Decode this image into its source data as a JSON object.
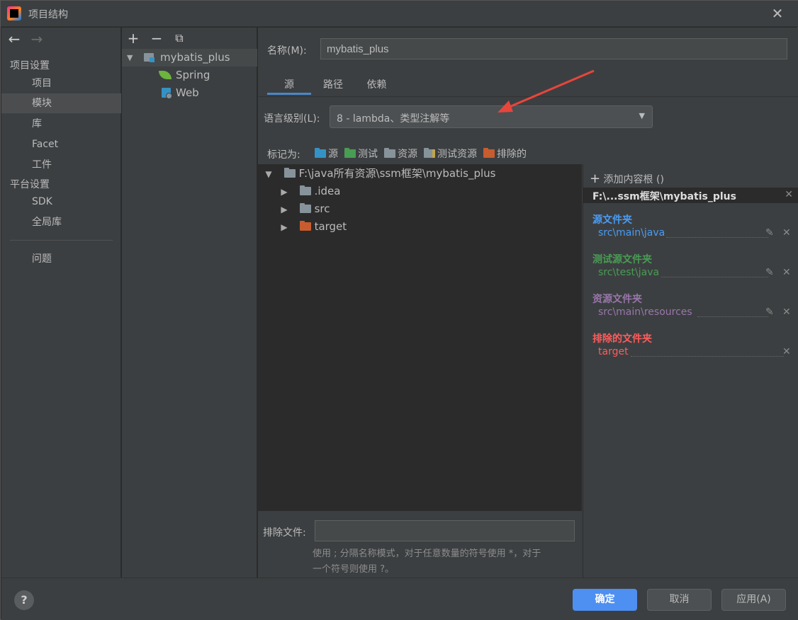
{
  "window": {
    "title": "项目结构",
    "close_glyph": "✕"
  },
  "nav": {
    "back_glyph": "←",
    "forward_glyph": "→",
    "project_settings_header": "项目设置",
    "project_items": [
      "项目",
      "模块",
      "库",
      "Facet",
      "工件"
    ],
    "platform_settings_header": "平台设置",
    "platform_items": [
      "SDK",
      "全局库"
    ],
    "problems_label": "问题",
    "selected": "模块"
  },
  "module_list": {
    "toolbar": {
      "add_glyph": "+",
      "remove_glyph": "−",
      "copy_glyph": "⧉"
    },
    "module_name": "mybatis_plus",
    "facets": [
      "Spring",
      "Web"
    ]
  },
  "main": {
    "name_label": "名称(M):",
    "name_value": "mybatis_plus",
    "tabs": [
      "源",
      "路径",
      "依赖"
    ],
    "active_tab": "源",
    "language_level_label": "语言级别(L):",
    "language_level_value": "8 - lambda、类型注解等",
    "mark_as_label": "标记为:",
    "mark_buttons": [
      "源",
      "测试",
      "资源",
      "测试资源",
      "排除的"
    ],
    "tree": {
      "root": "F:\\java所有资源\\ssm框架\\mybatis_plus",
      "children": [
        ".idea",
        "src",
        "target"
      ]
    },
    "exclude_files_label": "排除文件:",
    "exclude_files_value": "",
    "exclude_hint_line1": "使用 ; 分隔名称模式，对于任意数量的符号使用 *，对于",
    "exclude_hint_line2": "一个符号则使用 ?。"
  },
  "content_roots": {
    "add_label": "添加内容根 ()",
    "root_path": "F:\\...ssm框架\\mybatis_plus",
    "sections": [
      {
        "title": "源文件夹",
        "path": "src\\main\\java",
        "color": "#4a9cf5"
      },
      {
        "title": "测试源文件夹",
        "path": "src\\test\\java",
        "color": "#499c54"
      },
      {
        "title": "资源文件夹",
        "path": "src\\main\\resources",
        "color": "#9876aa"
      },
      {
        "title": "排除的文件夹",
        "path": "target",
        "color": "#ff5c5c"
      }
    ]
  },
  "footer": {
    "help_glyph": "?",
    "ok_label": "确定",
    "cancel_label": "取消",
    "apply_label": "应用(A)"
  },
  "colors": {
    "accent": "#4a88c7",
    "primary_button": "#4e8ff2",
    "annotation_arrow": "#e8453c"
  }
}
